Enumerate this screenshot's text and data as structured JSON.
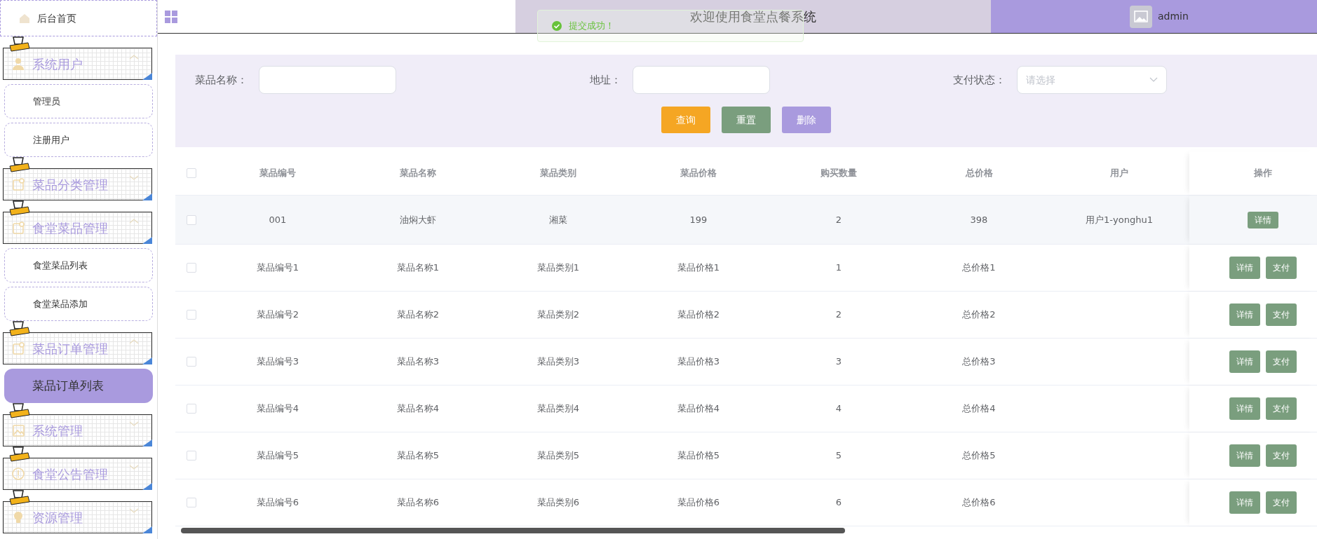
{
  "sidebar": {
    "home": {
      "label": "后台首页"
    },
    "groups": [
      {
        "label": "系统用户",
        "expanded": true,
        "children": [
          {
            "label": "管理员",
            "selected": false
          },
          {
            "label": "注册用户",
            "selected": false
          }
        ]
      },
      {
        "label": "菜品分类管理",
        "expanded": false
      },
      {
        "label": "食堂菜品管理",
        "expanded": true,
        "children": [
          {
            "label": "食堂菜品列表",
            "selected": false
          },
          {
            "label": "食堂菜品添加",
            "selected": false
          }
        ]
      },
      {
        "label": "菜品订单管理",
        "expanded": true,
        "children": [
          {
            "label": "菜品订单列表",
            "selected": true
          }
        ]
      },
      {
        "label": "系统管理",
        "expanded": false
      },
      {
        "label": "食堂公告管理",
        "expanded": false
      },
      {
        "label": "资源管理",
        "expanded": false
      }
    ]
  },
  "header": {
    "title": "欢迎使用食堂点餐系统",
    "user": "admin"
  },
  "toast": {
    "message": "提交成功！"
  },
  "search": {
    "fields": [
      {
        "label": "菜品名称：",
        "kind": "input"
      },
      {
        "label": "地址：",
        "kind": "input"
      },
      {
        "label": "支付状态：",
        "kind": "select",
        "placeholder": "请选择"
      }
    ],
    "buttons": [
      {
        "label": "查询",
        "kind": "query"
      },
      {
        "label": "重置",
        "kind": "reset"
      },
      {
        "label": "删除",
        "kind": "delete"
      }
    ]
  },
  "table": {
    "select_all": false,
    "columns": [
      "菜品编号",
      "菜品名称",
      "菜品类别",
      "菜品价格",
      "购买数量",
      "总价格",
      "用户",
      "操作"
    ],
    "rows": [
      {
        "checked": false,
        "hovered": true,
        "cells": [
          "001",
          "油焖大虾",
          "湘菜",
          "199",
          "2",
          "398",
          "用户1-yonghu1"
        ],
        "actions": [
          "详情"
        ]
      },
      {
        "checked": false,
        "hovered": false,
        "cells": [
          "菜品编号1",
          "菜品名称1",
          "菜品类别1",
          "菜品价格1",
          "1",
          "总价格1"
        ],
        "actions": [
          "详情",
          "支付"
        ]
      },
      {
        "checked": false,
        "hovered": false,
        "cells": [
          "菜品编号2",
          "菜品名称2",
          "菜品类别2",
          "菜品价格2",
          "2",
          "总价格2"
        ],
        "actions": [
          "详情",
          "支付"
        ]
      },
      {
        "checked": false,
        "hovered": false,
        "cells": [
          "菜品编号3",
          "菜品名称3",
          "菜品类别3",
          "菜品价格3",
          "3",
          "总价格3"
        ],
        "actions": [
          "详情",
          "支付"
        ]
      },
      {
        "checked": false,
        "hovered": false,
        "cells": [
          "菜品编号4",
          "菜品名称4",
          "菜品类别4",
          "菜品价格4",
          "4",
          "总价格4"
        ],
        "actions": [
          "详情",
          "支付"
        ]
      },
      {
        "checked": false,
        "hovered": false,
        "cells": [
          "菜品编号5",
          "菜品名称5",
          "菜品类别5",
          "菜品价格5",
          "5",
          "总价格5"
        ],
        "actions": [
          "详情",
          "支付"
        ]
      },
      {
        "checked": false,
        "hovered": false,
        "cells": [
          "菜品编号6",
          "菜品名称6",
          "菜品类别6",
          "菜品价格6",
          "6",
          "总价格6"
        ],
        "actions": [
          "详情",
          "支付"
        ]
      }
    ]
  }
}
